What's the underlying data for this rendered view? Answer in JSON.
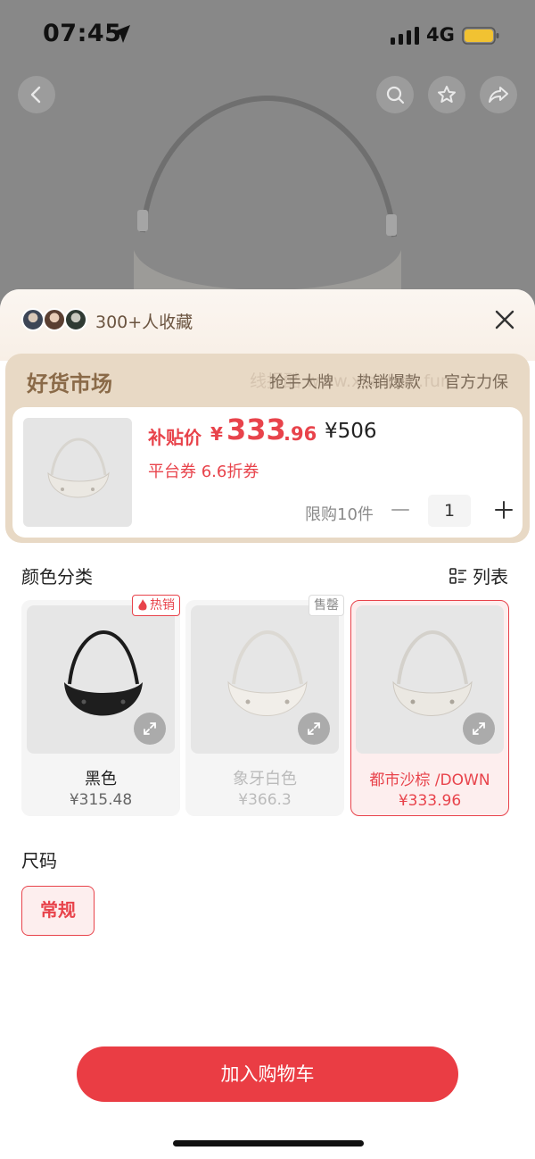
{
  "status_bar": {
    "time": "07:45",
    "network": "4G"
  },
  "icons": {
    "back": "chevron-left-icon",
    "search": "search-icon",
    "favorite": "star-icon",
    "share": "share-icon",
    "close": "close-icon",
    "list": "list-view-icon",
    "expand": "expand-icon",
    "hot": "flame-icon"
  },
  "colors": {
    "accent": "#E8434B",
    "promo_bg": "#E8D9C5",
    "promo_title": "#8A6A48"
  },
  "sheet": {
    "favorites_text": "300+人收藏"
  },
  "promo": {
    "title": "好货市场",
    "tags": [
      "抢手大牌",
      "热销爆款",
      "官方力保"
    ],
    "watermark": "线报酷 www.xianbao.fun"
  },
  "price_card": {
    "subsidy_label": "补贴价",
    "currency": "¥",
    "price_integer": "333",
    "price_decimal": ".96",
    "original_price": "¥506",
    "coupon": "平台券 6.6折券",
    "limit_text": "限购10件",
    "quantity": "1"
  },
  "color_section": {
    "title": "颜色分类",
    "list_toggle": "列表",
    "variants": [
      {
        "name": "黑色",
        "price": "¥315.48",
        "badge": "热销",
        "state": "normal"
      },
      {
        "name": "象牙白色",
        "price": "¥366.3",
        "badge": "售罄",
        "state": "sold_out"
      },
      {
        "name": "都市沙棕 /DOWN",
        "price": "¥333.96",
        "badge": "",
        "state": "selected"
      }
    ]
  },
  "size_section": {
    "title": "尺码",
    "options": [
      "常规"
    ]
  },
  "cart_button": "加入购物车"
}
